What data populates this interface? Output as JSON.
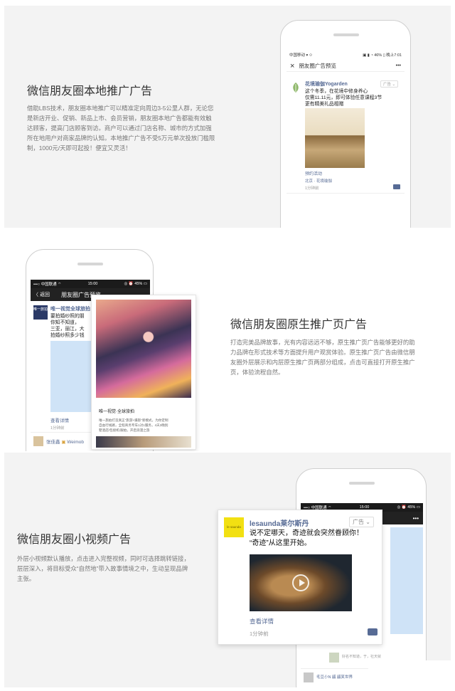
{
  "section1": {
    "title": "微信朋友圈本地推广广告",
    "desc_lines": [
      "借助LBS技术，朋友圈本地推广可以精准定向周边3-5公里人群，无论您",
      "是新店开业、促销、新品上市、会员营销，朋友圈本地广告都能有效触",
      "达顾客，提高门店顾客到访。商户可以通过门店名称、城市的方式加强",
      "所在地用户对商家品牌的认知。本地推广广告不受5万元单次投放门槛限",
      "制，1000元/天即可起投！便宜又灵活！"
    ],
    "phone": {
      "status_left": "中国移动 ▾ ⟐",
      "status_right": "▣ ▮ ◔ 46% ▯ 晚上7:01",
      "nav_close": "×",
      "nav_title": "朋友圈广告预览",
      "nav_more": "•••",
      "ad_name": "花境瑜伽Yogarden",
      "ad_tag": "广告 ⌄",
      "ad_text": [
        "这个冬季，在花境中修身养心",
        "仅需11.11元，即可体验任意课程3节",
        "更有精美礼品相赠"
      ],
      "ad_link": "预约活动",
      "ad_location": "北京 · 花境瑜伽",
      "ad_time": "1分钟前"
    }
  },
  "section2": {
    "title": "微信朋友圈原生推广页广告",
    "desc_lines": [
      "打造完美品牌故事，光有内容远远不够，原生推广页广告能够更好的助",
      "力品牌在形式技术等方面提升用户观赏体验。原生推广页广告由微信朋",
      "友圈外层展示和内层原生推广页两部分组成，点击可直接打开原生推广",
      "页，体验流程自然。"
    ],
    "phone": {
      "status_left": "•••○ 中国联通 ⌔",
      "status_time": "15:00",
      "status_right": "◎ ⏰ 45% ▭",
      "nav_back": "〈 返回",
      "nav_title": "朋友圈广告预览",
      "ad_name": "唯一视觉全球旅拍",
      "ad_logo": "唯一旅拍",
      "ad_text": [
        "要拍婚纱照的朋",
        "你知不知道，",
        "三亚，丽江，大",
        "拍婚纱照多少钱"
      ],
      "ad_link": "查看详情",
      "ad_time": "1分钟前",
      "next_name": "张佳鑫",
      "next_brand": "Weimob"
    },
    "popup": {
      "caption": "唯一视觉·全球旅拍",
      "lines": [
        "唯一旅拍打造真正“旅游+摄影”新模式，为你定制",
        "自由行线路，全程商务专车1对1服务，4天3晚别",
        "墅酒店/包接机/跟拍，开启浪漫之旅"
      ]
    }
  },
  "section3": {
    "title": "微信朋友圈小视频广告",
    "desc_lines": [
      "外层小视频默认播放，点击进入完整视频，同时可选择跳转链接，",
      "层层深入，将目标受众“自然地”带入故事情境之中，生动呈现品牌",
      "主张。"
    ],
    "phone": {
      "status_left": "•••○ 中国联通 ⌔",
      "status_time": "15:00",
      "status_right": "◎ ⏰ 45% ▭",
      "nav_title_tail": "览",
      "nav_more": "•••"
    },
    "card": {
      "logo_text": "le saunda",
      "name": "lesaunda莱尔斯丹",
      "tag": "广告 ⌄",
      "text_lines": [
        "说不定哪天，奇迹就会突然眷顾你！",
        "“奇迹”从这里开始。"
      ],
      "link": "查看详情",
      "time": "1分钟前"
    },
    "below": {
      "comment": "好名不知道，于，社天就",
      "next_name": "毛豆小N 鼷 鼷笑世界"
    }
  }
}
